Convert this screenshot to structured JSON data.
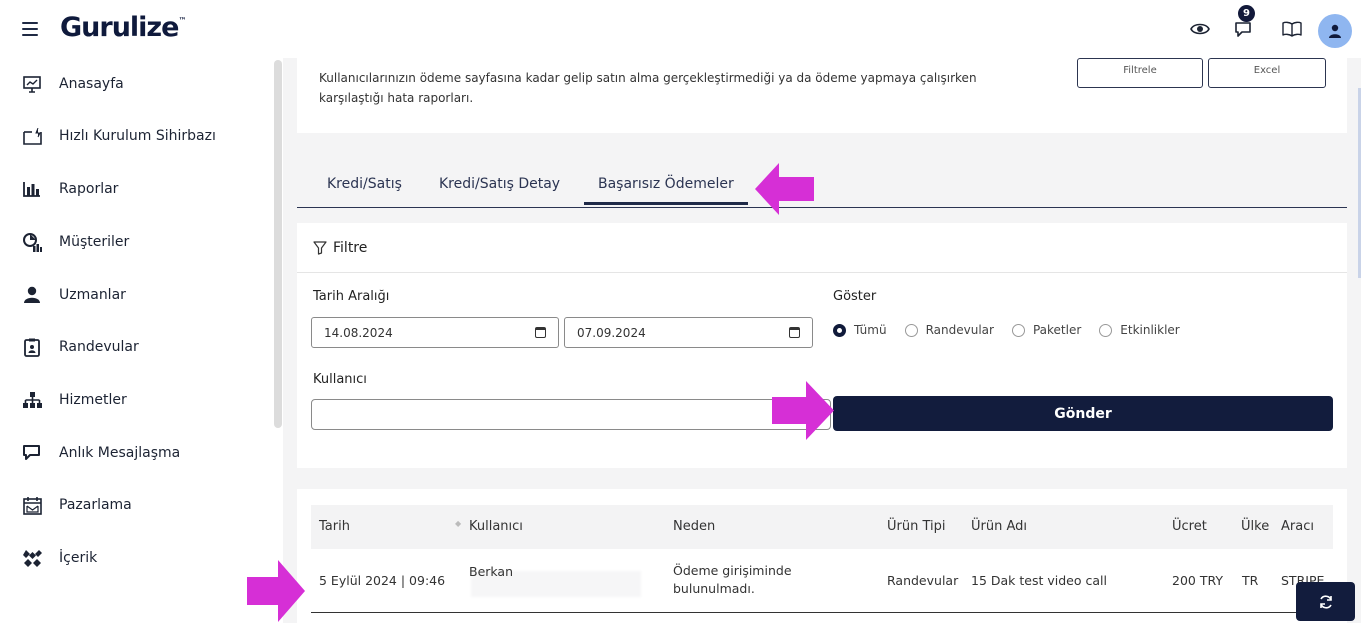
{
  "header": {
    "logo": "Gurulize",
    "logo_mark": "™",
    "notification_count": "9"
  },
  "sidebar": {
    "items": [
      {
        "label": "Anasayfa",
        "icon": "dashboard-icon"
      },
      {
        "label": "Hızlı Kurulum Sihirbazı",
        "icon": "setup-icon"
      },
      {
        "label": "Raporlar",
        "icon": "bar-chart-icon"
      },
      {
        "label": "Müşteriler",
        "icon": "customers-icon"
      },
      {
        "label": "Uzmanlar",
        "icon": "user-icon"
      },
      {
        "label": "Randevular",
        "icon": "appointment-icon"
      },
      {
        "label": "Hizmetler",
        "icon": "sitemap-icon"
      },
      {
        "label": "Anlık Mesajlaşma",
        "icon": "chat-icon"
      },
      {
        "label": "Pazarlama",
        "icon": "marketing-icon"
      },
      {
        "label": "İçerik",
        "icon": "content-icon"
      }
    ]
  },
  "intro": {
    "description": "Kullanıcılarınızın ödeme sayfasına kadar gelip satın alma gerçekleştirmediği ya da ödeme yapmaya çalışırken karşılaştığı hata raporları.",
    "filter_button": "Filtrele",
    "excel_button": "Excel"
  },
  "tabs": [
    "Kredi/Satış",
    "Kredi/Satış Detay",
    "Başarısız Ödemeler"
  ],
  "active_tab": "Başarısız Ödemeler",
  "filter": {
    "title": "Filtre",
    "date_range_label": "Tarih Aralığı",
    "date_from": "14.08.2024",
    "date_to": "07.09.2024",
    "show_label": "Göster",
    "show_options": [
      "Tümü",
      "Randevular",
      "Paketler",
      "Etkinlikler"
    ],
    "show_selected": "Tümü",
    "user_label": "Kullanıcı",
    "user_value": "",
    "submit_label": "Gönder"
  },
  "table": {
    "columns": [
      "Tarih",
      "Kullanıcı",
      "Neden",
      "Ürün Tipi",
      "Ürün Adı",
      "Ücret",
      "Ülke",
      "Aracı"
    ],
    "rows": [
      {
        "date": "5 Eylül 2024 | 09:46",
        "user": "Berkan",
        "reason_line1": "Ödeme girişiminde",
        "reason_line2": "bulunulmadı.",
        "product_type": "Randevular",
        "product_name": "15 Dak test video call",
        "price": "200 TRY",
        "country": "TR",
        "provider": "STRIPE"
      }
    ]
  },
  "colors": {
    "navy": "#121c3d",
    "annotation_arrow": "#d62fd6",
    "avatar": "#8fb6f0"
  }
}
